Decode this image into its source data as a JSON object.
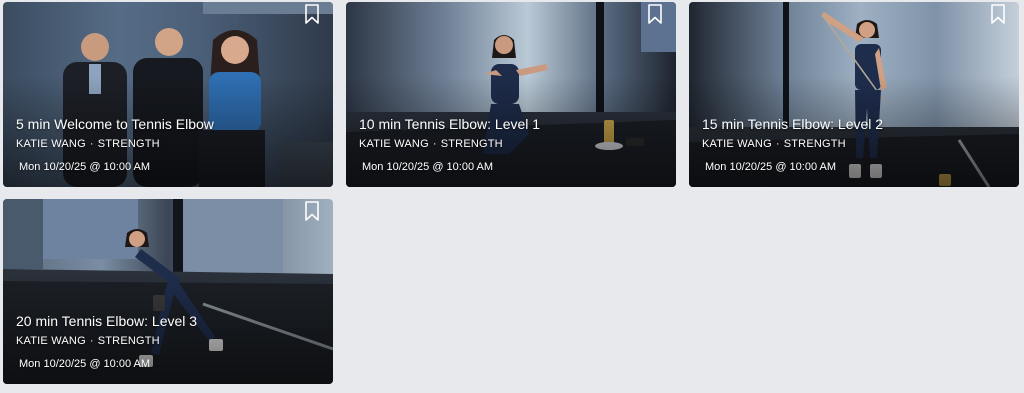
{
  "cards": [
    {
      "title": "5 min Welcome to Tennis Elbow",
      "instructor": "KATIE WANG",
      "separator": "·",
      "category": "STRENGTH",
      "date": "Mon 10/20/25 @ 10:00 AM"
    },
    {
      "title": "10 min Tennis Elbow: Level 1",
      "instructor": "KATIE WANG",
      "separator": "·",
      "category": "STRENGTH",
      "date": "Mon 10/20/25 @ 10:00 AM"
    },
    {
      "title": "15 min Tennis Elbow: Level 2",
      "instructor": "KATIE WANG",
      "separator": "·",
      "category": "STRENGTH",
      "date": "Mon 10/20/25 @ 10:00 AM"
    },
    {
      "title": "20 min Tennis Elbow: Level 3",
      "instructor": "KATIE WANG",
      "separator": "·",
      "category": "STRENGTH",
      "date": "Mon 10/20/25 @ 10:00 AM"
    }
  ],
  "icons": {
    "bookmark": "bookmark-icon"
  },
  "colors": {
    "page_background": "#e8e9ec",
    "card_text": "#ffffff"
  }
}
